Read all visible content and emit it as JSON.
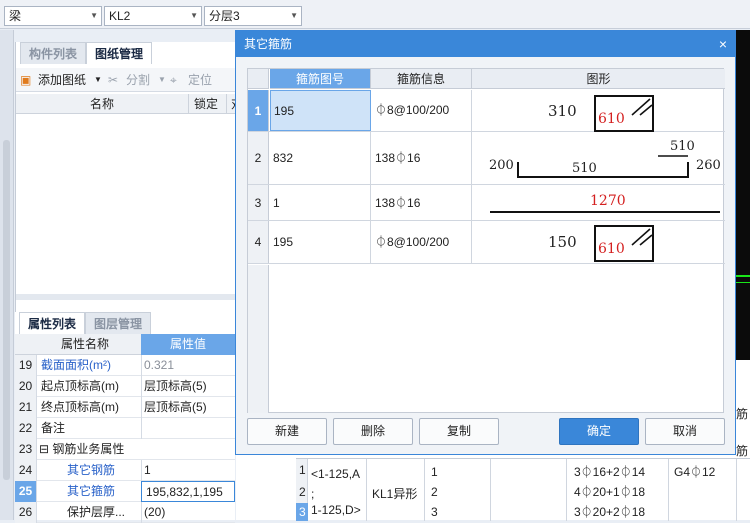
{
  "top_bar": {
    "combo1": "梁",
    "combo2": "KL2",
    "combo3": "分层3"
  },
  "left_panel": {
    "tabs": [
      "构件列表",
      "图纸管理"
    ],
    "toolbar": {
      "add_drawing": "添加图纸",
      "split": "分割",
      "locate": "定位"
    },
    "columns": [
      "名称",
      "锁定",
      "对"
    ]
  },
  "properties": {
    "tabs": [
      "属性列表",
      "图层管理"
    ],
    "columns": [
      "属性名称",
      "属性值"
    ],
    "rows": [
      {
        "num": "19",
        "name": "截面面积(m²)",
        "value": "0.321"
      },
      {
        "num": "20",
        "name": "起点顶标高(m)",
        "value": "层顶标高(5)"
      },
      {
        "num": "21",
        "name": "终点顶标高(m)",
        "value": "层顶标高(5)"
      },
      {
        "num": "22",
        "name": "备注",
        "value": ""
      },
      {
        "num": "23",
        "name": "⊟ 钢筋业务属性",
        "value": ""
      },
      {
        "num": "24",
        "name": "其它钢筋",
        "value": "1"
      },
      {
        "num": "25",
        "name": "其它箍筋",
        "value": "195,832,1,195"
      },
      {
        "num": "26",
        "name": "保护层厚...",
        "value": "(20)"
      }
    ],
    "ellipsis": "···"
  },
  "dialog": {
    "title": "其它箍筋",
    "close": "×",
    "columns": [
      "箍筋图号",
      "箍筋信息",
      "图形"
    ],
    "rows": [
      {
        "num": "1",
        "code": "195",
        "info": "⏀8@100/200",
        "shape": {
          "left": "310",
          "box": "610"
        }
      },
      {
        "num": "2",
        "code": "832",
        "info": "138⏀16",
        "shape": {
          "top": "510",
          "left": "200",
          "mid": "510",
          "right": "260"
        }
      },
      {
        "num": "3",
        "code": "1",
        "info": "138⏀16",
        "shape": {
          "len": "1270"
        }
      },
      {
        "num": "4",
        "code": "195",
        "info": "⏀8@100/200",
        "shape": {
          "left": "150",
          "box": "610"
        }
      }
    ],
    "buttons": {
      "new": "新建",
      "delete": "删除",
      "copy": "复制",
      "ok": "确定",
      "cancel": "取消"
    }
  },
  "bottom_table": {
    "row_nums": [
      "1",
      "2",
      "3"
    ],
    "axis_text": [
      "<1-125,A",
      ";",
      "1-125,D>"
    ],
    "member": "KL1异形",
    "spans": [
      "1",
      "2",
      "3"
    ],
    "bars": [
      "3⏀16+2⏀14",
      "4⏀20+1⏀18",
      "3⏀20+2⏀18"
    ],
    "stirrup": "G4⏀12",
    "side1": "筋",
    "side2": "筋"
  },
  "colors": {
    "accent": "#3a87d9",
    "dim_red": "#d42020"
  }
}
